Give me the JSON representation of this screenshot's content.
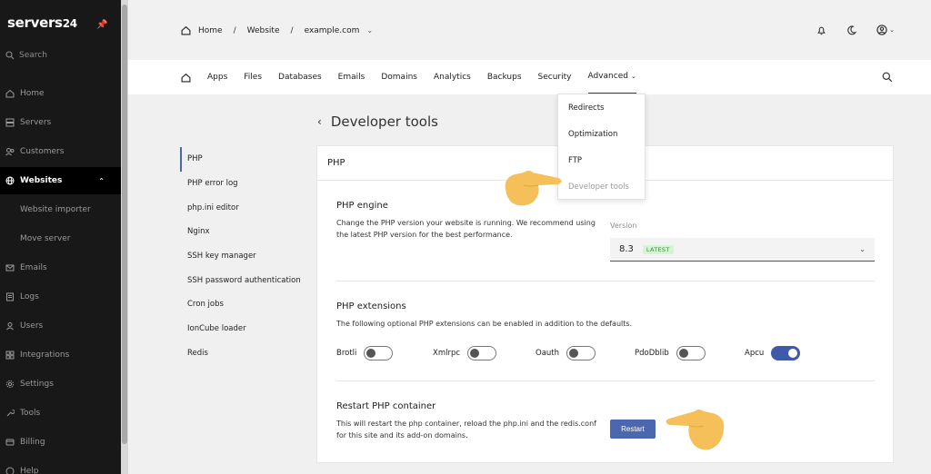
{
  "sidebar": {
    "brand": "servers",
    "brand_num": "24",
    "search_label": "Search",
    "items": [
      {
        "label": "Home",
        "icon": "home-icon"
      },
      {
        "label": "Servers",
        "icon": "server-icon"
      },
      {
        "label": "Customers",
        "icon": "customers-icon"
      },
      {
        "label": "Websites",
        "icon": "globe-icon"
      },
      {
        "label": "Website importer",
        "icon": ""
      },
      {
        "label": "Move server",
        "icon": ""
      },
      {
        "label": "Emails",
        "icon": "mail-icon"
      },
      {
        "label": "Logs",
        "icon": "logs-icon"
      },
      {
        "label": "Users",
        "icon": "users-icon"
      },
      {
        "label": "Integrations",
        "icon": "integrations-icon"
      },
      {
        "label": "Settings",
        "icon": "gear-icon"
      },
      {
        "label": "Tools",
        "icon": "tools-icon"
      },
      {
        "label": "Billing",
        "icon": "billing-icon"
      },
      {
        "label": "Help",
        "icon": "help-icon"
      }
    ]
  },
  "header": {
    "breadcrumb": [
      "Home",
      "Website",
      "example.com"
    ]
  },
  "tabs": [
    "Apps",
    "Files",
    "Databases",
    "Emails",
    "Domains",
    "Analytics",
    "Backups",
    "Security",
    "Advanced"
  ],
  "advanced_menu": [
    "Redirects",
    "Optimization",
    "FTP",
    "Developer tools"
  ],
  "page": {
    "title": "Developer tools",
    "submenu": [
      "PHP",
      "PHP error log",
      "php.ini editor",
      "Nginx",
      "SSH key manager",
      "SSH password authentication",
      "Cron jobs",
      "IonCube loader",
      "Redis"
    ]
  },
  "card": {
    "title": "PHP",
    "engine": {
      "heading": "PHP engine",
      "desc_line1": "Change the PHP version your website is running. We recommend using",
      "desc_line2": "the latest PHP version for the best performance.",
      "version_label": "Version",
      "version_value": "8.3",
      "version_badge": "LATEST"
    },
    "extensions": {
      "heading": "PHP extensions",
      "desc": "The following optional PHP extensions can be enabled in addition to the defaults.",
      "items": [
        {
          "label": "Brotli",
          "enabled": false
        },
        {
          "label": "Xmlrpc",
          "enabled": false
        },
        {
          "label": "Oauth",
          "enabled": false
        },
        {
          "label": "PdoDblib",
          "enabled": false
        },
        {
          "label": "Apcu",
          "enabled": true
        }
      ]
    },
    "restart": {
      "heading": "Restart PHP container",
      "desc_line1": "This will restart the php container, reload the php.ini and the redis.conf",
      "desc_line2": "for this site and its add-on domains.",
      "button": "Restart"
    }
  },
  "colors": {
    "sidebar_bg": "#181818",
    "accent": "#4a67b0",
    "badge_bg": "#d8f2d8",
    "badge_text": "#3b8a3b",
    "pointer": "#f5bf5a"
  }
}
